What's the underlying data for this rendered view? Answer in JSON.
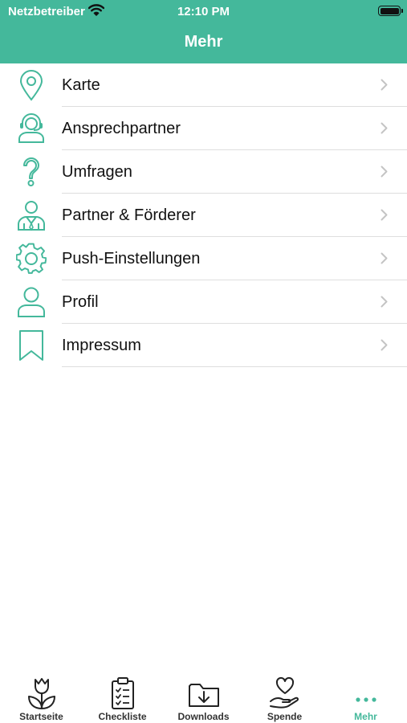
{
  "status_bar": {
    "carrier": "Netzbetreiber",
    "time": "12:10 PM"
  },
  "header": {
    "title": "Mehr"
  },
  "theme": {
    "accent": "#44b89b"
  },
  "menu": {
    "items": [
      {
        "label": "Karte",
        "icon": "map-pin-icon"
      },
      {
        "label": "Ansprechpartner",
        "icon": "headset-person-icon"
      },
      {
        "label": "Umfragen",
        "icon": "question-icon"
      },
      {
        "label": "Partner & Förderer",
        "icon": "business-person-icon"
      },
      {
        "label": "Push-Einstellungen",
        "icon": "gear-icon"
      },
      {
        "label": "Profil",
        "icon": "person-icon"
      },
      {
        "label": "Impressum",
        "icon": "bookmark-icon"
      }
    ]
  },
  "tabbar": {
    "tabs": [
      {
        "label": "Startseite",
        "icon": "tulip-icon"
      },
      {
        "label": "Checkliste",
        "icon": "clipboard-checklist-icon"
      },
      {
        "label": "Downloads",
        "icon": "folder-download-icon"
      },
      {
        "label": "Spende",
        "icon": "heart-hand-icon"
      },
      {
        "label": "Mehr",
        "icon": "more-dots-icon"
      }
    ],
    "active": "Mehr"
  }
}
